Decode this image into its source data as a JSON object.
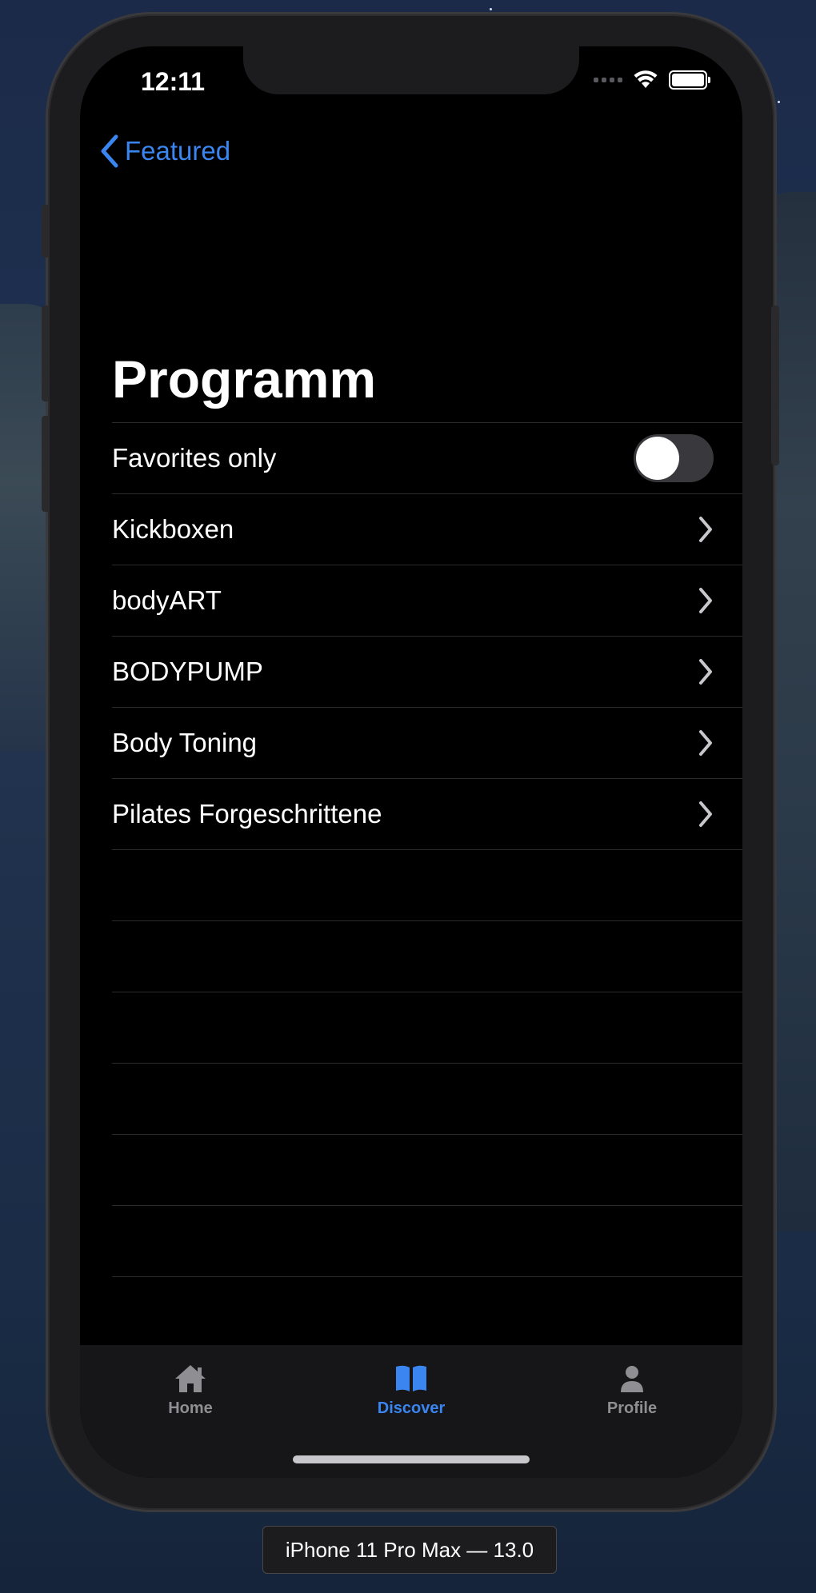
{
  "status_bar": {
    "time": "12:11"
  },
  "nav": {
    "back_label": "Featured"
  },
  "page": {
    "title": "Programm"
  },
  "list": {
    "toggle_row": {
      "label": "Favorites only",
      "enabled": false
    },
    "items": [
      {
        "label": "Kickboxen"
      },
      {
        "label": "bodyART"
      },
      {
        "label": "BODYPUMP"
      },
      {
        "label": "Body Toning"
      },
      {
        "label": "Pilates Forgeschrittene"
      }
    ]
  },
  "tabbar": {
    "tabs": [
      {
        "label": "Home",
        "icon": "house-icon",
        "active": false
      },
      {
        "label": "Discover",
        "icon": "book-icon",
        "active": true
      },
      {
        "label": "Profile",
        "icon": "person-icon",
        "active": false
      }
    ]
  },
  "simulator": {
    "device_label": "iPhone 11 Pro Max — 13.0"
  },
  "colors": {
    "accent": "#3a85f0",
    "background": "#000000",
    "tabbar": "#161618"
  }
}
